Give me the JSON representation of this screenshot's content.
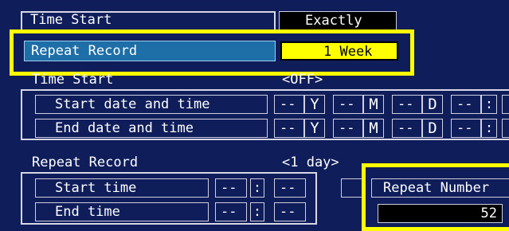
{
  "row_top": {
    "label": "Time Start",
    "value": "Exactly"
  },
  "repeat_record_top": {
    "label": "Repeat Record",
    "value": "1 Week"
  },
  "time_start_section": {
    "title": "Time Start",
    "state": "<OFF>",
    "rows": [
      {
        "label": "Start date and time",
        "y": "--",
        "y_unit": "Y",
        "m": "--",
        "m_unit": "M",
        "d": "--",
        "d_unit": "D",
        "h": "--",
        "sep": ":"
      },
      {
        "label": "End date and time",
        "y": "--",
        "y_unit": "Y",
        "m": "--",
        "m_unit": "M",
        "d": "--",
        "d_unit": "D",
        "h": "--",
        "sep": ":"
      }
    ]
  },
  "repeat_record_section": {
    "title": "Repeat Record",
    "state": "<1 day>",
    "rows": [
      {
        "label": "Start time",
        "h": "--",
        "sep": ":",
        "m": "--"
      },
      {
        "label": "End time",
        "h": "--",
        "sep": ":",
        "m": "--"
      }
    ]
  },
  "repeat_number": {
    "label": "Repeat Number",
    "value": "52"
  },
  "colors": {
    "background": "#0f1e5a",
    "highlight_row": "#1e6ea8",
    "yellow": "#ffff00",
    "value_black": "#000000"
  }
}
